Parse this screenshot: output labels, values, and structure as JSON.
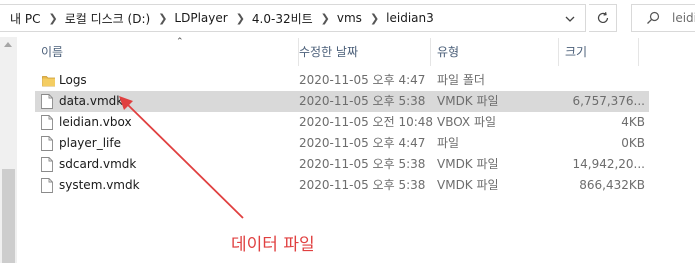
{
  "addressbar": {
    "crumbs": [
      "내 PC",
      "로컬 디스크 (D:)",
      "LDPlayer",
      "4.0-32비트",
      "vms",
      "leidian3"
    ],
    "search_placeholder": "leidi"
  },
  "columns": {
    "name": "이름",
    "date": "수정한 날짜",
    "type": "유형",
    "size": "크기"
  },
  "files": [
    {
      "name": "Logs",
      "date": "2020-11-05 오후 4:47",
      "type": "파일 폴더",
      "size": "",
      "icon": "folder-icon",
      "selected": false
    },
    {
      "name": "data.vmdk",
      "date": "2020-11-05 오후 5:38",
      "type": "VMDK 파일",
      "size": "6,757,376...",
      "icon": "file-icon",
      "selected": true
    },
    {
      "name": "leidian.vbox",
      "date": "2020-11-05 오전 10:48",
      "type": "VBOX 파일",
      "size": "4KB",
      "icon": "file-icon",
      "selected": false
    },
    {
      "name": "player_life",
      "date": "2020-11-05 오후 4:47",
      "type": "파일",
      "size": "0KB",
      "icon": "file-icon",
      "selected": false
    },
    {
      "name": "sdcard.vmdk",
      "date": "2020-11-05 오후 5:38",
      "type": "VMDK 파일",
      "size": "14,942,20...",
      "icon": "file-icon",
      "selected": false
    },
    {
      "name": "system.vmdk",
      "date": "2020-11-05 오후 5:38",
      "type": "VMDK 파일",
      "size": "866,432KB",
      "icon": "file-icon",
      "selected": false
    }
  ],
  "annotation": {
    "label": "데이터 파일",
    "color": "#e04040"
  },
  "colors": {
    "selected_row": "#d9d9d9",
    "folder": "#e8b84a",
    "header_text": "#4c607a"
  }
}
